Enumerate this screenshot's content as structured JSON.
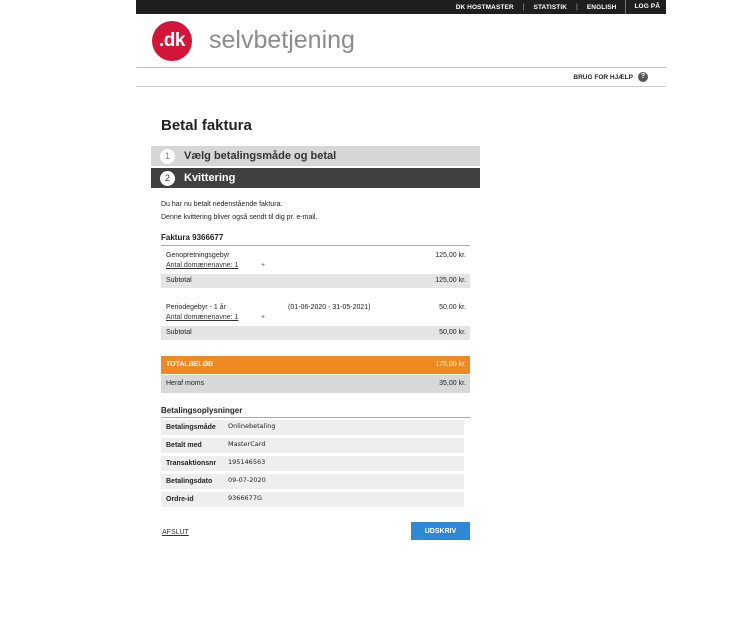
{
  "topnav": {
    "items": [
      "DK HOSTMASTER",
      "STATISTIK",
      "ENGLISH"
    ],
    "separator": "|",
    "login": "LOG PÅ"
  },
  "brand": {
    "mark": ".dk",
    "name": "selvbetjening",
    "color": "#d3153a"
  },
  "help": {
    "label": "BRUG FOR HJÆLP",
    "icon": "?"
  },
  "page": {
    "title": "Betal faktura"
  },
  "steps": [
    {
      "num": "1",
      "label": "Vælg betalingsmåde og betal"
    },
    {
      "num": "2",
      "label": "Kvittering"
    }
  ],
  "intro": [
    "Du har nu betalt nedenstående faktura.",
    "Denne kvittering bliver også sendt til dig pr. e-mail."
  ],
  "invoice": {
    "title": "Faktura 9366677",
    "lines": [
      {
        "label": "Genopretningsgebyr",
        "sub": "Antal domænenavne: 1",
        "plus": "+",
        "period": "",
        "amount": "125,00 kr.",
        "subtotal_label": "Subtotal",
        "subtotal": "125,00 kr."
      },
      {
        "label": "Periodegebyr - 1 år",
        "sub": "Antal domænenavne: 1",
        "plus": "+",
        "period": "(01-06-2020 - 31-05-2021)",
        "amount": "50,00 kr.",
        "subtotal_label": "Subtotal",
        "subtotal": "50,00 kr."
      }
    ],
    "total_label": "TOTALBELØB",
    "total": "175,00 kr.",
    "vat_label": "Heraf moms",
    "vat": "35,00 kr."
  },
  "payment": {
    "title": "Betalingsoplysninger",
    "rows": [
      {
        "key": "Betalingsmåde",
        "value": "Onlinebetaling"
      },
      {
        "key": "Betalt med",
        "value": "MasterCard"
      },
      {
        "key": "Transaktionsnr",
        "value": "195146563"
      },
      {
        "key": "Betalingsdato",
        "value": "09-07-2020"
      },
      {
        "key": "Ordre-id",
        "value": "9366677G"
      }
    ]
  },
  "actions": {
    "exit": "AFSLUT",
    "print": "UDSKRIV"
  },
  "colors": {
    "accent_orange": "#ef8a23",
    "button_blue": "#2f88d4",
    "dark_bar": "#1f1f1f"
  }
}
